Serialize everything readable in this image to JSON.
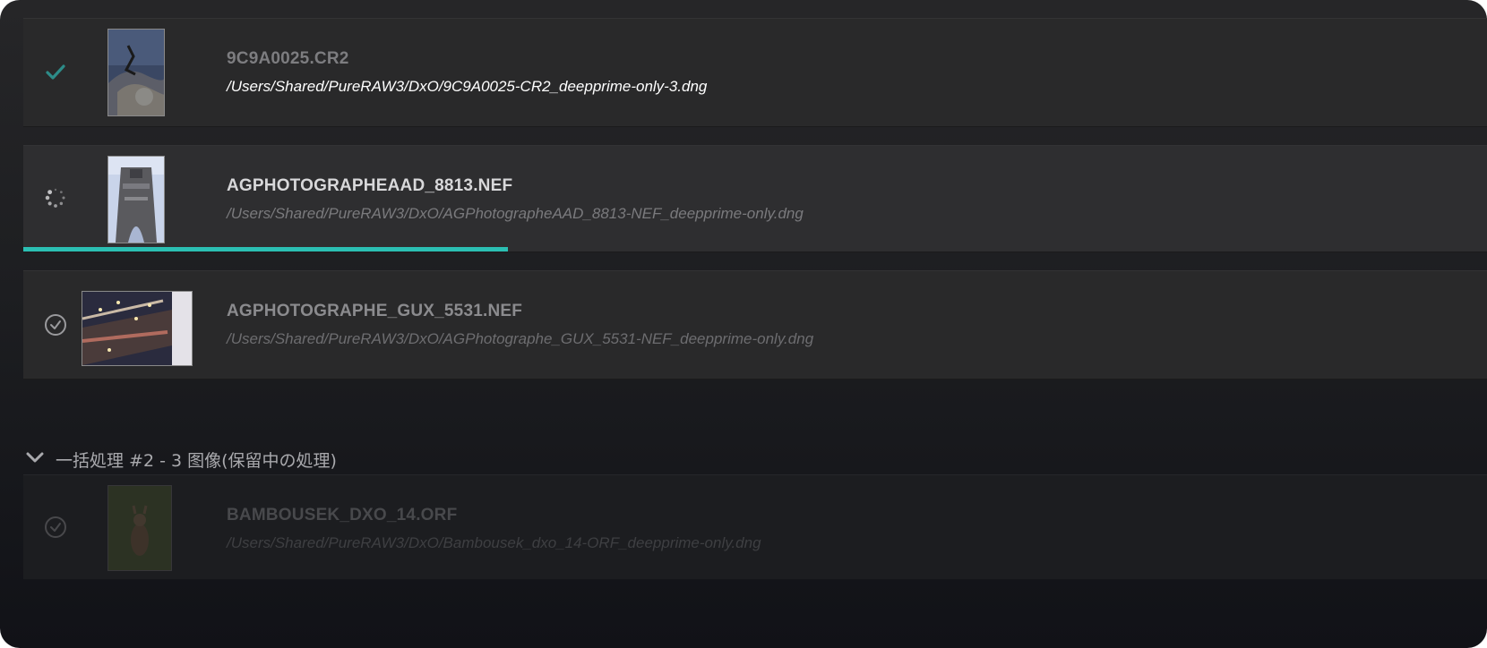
{
  "items": [
    {
      "filename": "9C9A0025.CR2",
      "path": "/Users/Shared/PureRAW3/DxO/9C9A0025-CR2_deepprime-only-3.dng",
      "status": "done",
      "status_icon": "check-icon"
    },
    {
      "filename": "AGPHOTOGRAPHEAAD_8813.NEF",
      "path": "/Users/Shared/PureRAW3/DxO/AGPhotographeAAD_8813-NEF_deepprime-only.dng",
      "status": "processing",
      "status_icon": "spinner-icon",
      "progress": 0.33
    },
    {
      "filename": "AGPHOTOGRAPHE_GUX_5531.NEF",
      "path": "/Users/Shared/PureRAW3/DxO/AGPhotographe_GUX_5531-NEF_deepprime-only.dng",
      "status": "queued",
      "status_icon": "circle-check-icon"
    }
  ],
  "group": {
    "label": "一括処理 #2 - 3 图像(保留中の処理)",
    "icon": "chevron-down-icon",
    "items": [
      {
        "filename": "BAMBOUSEK_DXO_14.ORF",
        "path": "/Users/Shared/PureRAW3/DxO/Bambousek_dxo_14-ORF_deepprime-only.dng",
        "status": "pending",
        "status_icon": "circle-check-icon"
      }
    ]
  },
  "colors": {
    "accent": "#2bbfb3",
    "background": "#1d1e21",
    "row": "#29292a"
  }
}
